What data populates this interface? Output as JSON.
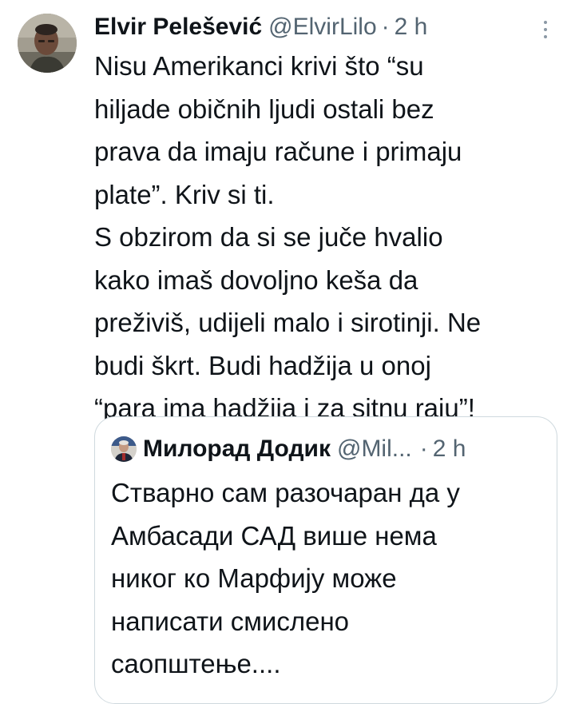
{
  "tweet": {
    "author_name": "Elvir Pelešević",
    "handle": "@ElvirLilo",
    "separator": "·",
    "time": "2 h",
    "body_lines": [
      "Nisu Amerikanci krivi što “su",
      "hiljade običnih ljudi ostali bez",
      "prava da imaju račune i primaju",
      "plate”. Kriv si ti.",
      "S obzirom da si se juče hvalio",
      "kako imaš dovoljno keša da",
      "preživiš, udijeli malo i sirotinji. Ne",
      "budi škrt. Budi hadžija u onoj",
      "“para ima hadžija i za sitnu raju”!"
    ],
    "more_icon": "more-vertical-icon",
    "avatar_icon": "profile-photo"
  },
  "quoted_tweet": {
    "author_name": "Милорад Додик",
    "handle": "@Mil...",
    "separator": "·",
    "time": "2 h",
    "avatar_icon": "profile-photo",
    "body_lines": [
      "Стварно сам разочаран да у",
      "Амбасади САД више нема",
      "никог ко Марфију може",
      "написати смислено",
      "саопштење...."
    ]
  },
  "colors": {
    "text": "#0f1419",
    "secondary_text": "#536471",
    "border": "#cfd9de",
    "background": "#ffffff"
  }
}
